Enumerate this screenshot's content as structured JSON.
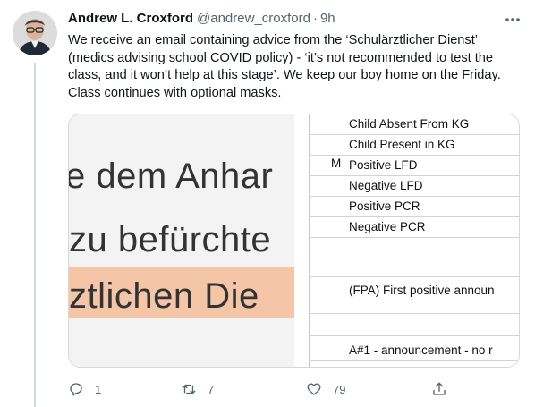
{
  "tweet": {
    "display_name": "Andrew L. Croxford",
    "handle": "@andrew_croxford",
    "dot": "·",
    "time": "9h",
    "text": "We receive an email containing advice from the ‘Schulärztlicher Dienst’ (medics advising school COVID policy) - ‘it’s not recommended to test the class, and it won’t help at this stage’. We keep our boy home on the Friday. Class continues with optional masks."
  },
  "media": {
    "zoom_lines": [
      "e dem Anhar",
      "zu befürchte",
      "ztlichen Die"
    ],
    "marker": "M",
    "rows": [
      "Child Absent From KG",
      "Child Present in KG",
      "Positive LFD",
      "Negative LFD",
      "Positive PCR",
      "Negative PCR",
      "(FPA) First positive announ",
      "A#1 -  announcement - no r"
    ]
  },
  "actions": {
    "replies": "1",
    "retweets": "7",
    "likes": "79"
  },
  "colors": {
    "secondary_text": "#536471",
    "highlight": "#f4c6a7",
    "border": "#cfd9de"
  },
  "icons": {
    "more": "more-horizontal-icon",
    "reply": "reply-icon",
    "retweet": "retweet-icon",
    "like": "heart-icon",
    "share": "share-icon"
  }
}
